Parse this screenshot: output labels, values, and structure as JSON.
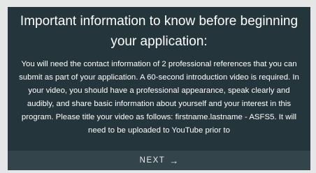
{
  "dialog": {
    "title": "Important information to know before beginning your application:",
    "body": "You will need the contact information of 2 professional references that you can submit as part of your application. A 60-second introduction video is required. In your video, you should have a professional appearance, speak clearly and audibly, and share basic information about yourself and your interest in this program. Please title your video as follows: firstname.lastname - ASFS5. It will need to be uploaded to YouTube prior to",
    "next_label": "NEXT",
    "next_icon": "→"
  },
  "colors": {
    "background": "#e4e6e8",
    "card": "#25353c",
    "footer": "#33444b",
    "text": "#ffffff"
  }
}
